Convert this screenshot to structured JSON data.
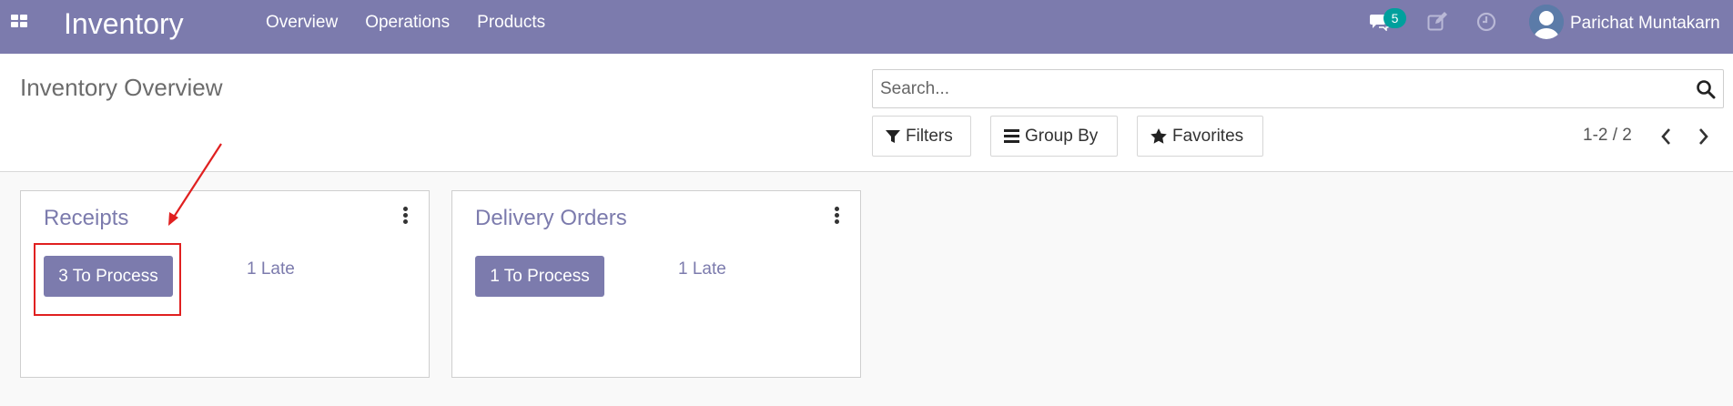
{
  "navbar": {
    "app_title": "Inventory",
    "menu": [
      {
        "label": "Overview"
      },
      {
        "label": "Operations"
      },
      {
        "label": "Products"
      }
    ],
    "messages_badge": "5",
    "user_name": "Parichat Muntakarn",
    "icons": [
      "apps-icon",
      "chat-icon",
      "edit-icon",
      "clock-icon",
      "avatar"
    ],
    "color": "#7c7bad"
  },
  "control_panel": {
    "title": "Inventory Overview",
    "search_placeholder": "Search...",
    "filters_label": "Filters",
    "group_by_label": "Group By",
    "favorites_label": "Favorites",
    "pager_value": "1-2 / 2"
  },
  "cards": [
    {
      "title": "Receipts",
      "process_label": "3 To Process",
      "late_label": "1 Late"
    },
    {
      "title": "Delivery Orders",
      "process_label": "1 To Process",
      "late_label": "1 Late"
    }
  ],
  "colors": {
    "accent": "#7c7bad",
    "badge": "#00a09d",
    "annotation": "#e02020"
  }
}
